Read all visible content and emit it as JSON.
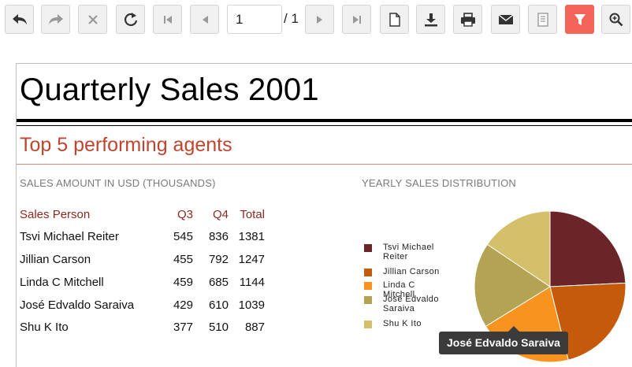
{
  "toolbar": {
    "current_page": "1",
    "total_pages": "/ 1",
    "buttons": [
      "back-icon",
      "forward-icon",
      "close-icon",
      "refresh-icon",
      "first-page-icon",
      "prev-page-icon",
      "next-page-icon",
      "last-page-icon",
      "document-icon",
      "download-icon",
      "print-icon",
      "email-icon",
      "document-map-icon",
      "filter-icon",
      "zoom-icon"
    ],
    "accent_color": "#f4645a"
  },
  "report": {
    "title": "Quarterly Sales 2001",
    "subtitle": "Top 5 performing agents",
    "sales_section_label": "SALES AMOUNT IN USD (THOUSANDS)",
    "chart_section_label": "YEARLY SALES DISTRIBUTION",
    "table": {
      "headers": [
        "Sales Person",
        "Q3",
        "Q4",
        "Total"
      ],
      "rows": [
        {
          "name": "Tsvi Michael Reiter",
          "q3": "545",
          "q4": "836",
          "total": "1381"
        },
        {
          "name": "Jillian  Carson",
          "q3": "455",
          "q4": "792",
          "total": "1247"
        },
        {
          "name": "Linda C Mitchell",
          "q3": "459",
          "q4": "685",
          "total": "1144"
        },
        {
          "name": "José Edvaldo Saraiva",
          "q3": "429",
          "q4": "610",
          "total": "1039"
        },
        {
          "name": "Shu K Ito",
          "q3": "377",
          "q4": "510",
          "total": "887"
        }
      ]
    },
    "legend": [
      {
        "label": "Tsvi Michael Reiter",
        "color": "#6b2428"
      },
      {
        "label": "Jillian  Carson",
        "color": "#c45a0a"
      },
      {
        "label": "Linda C Mitchell",
        "color": "#f7931e"
      },
      {
        "label": "José Edvaldo Saraiva",
        "color": "#b5a354"
      },
      {
        "label": "Shu K Ito",
        "color": "#d4c06a"
      }
    ],
    "tooltip": "José Edvaldo Saraiva"
  },
  "chart_data": {
    "type": "pie",
    "categories": [
      "Tsvi Michael Reiter",
      "Jillian  Carson",
      "Linda C Mitchell",
      "José Edvaldo Saraiva",
      "Shu K Ito"
    ],
    "values": [
      1381,
      1247,
      1144,
      1039,
      887
    ],
    "title": "YEARLY SALES DISTRIBUTION",
    "colors": [
      "#6b2428",
      "#c45a0a",
      "#f7931e",
      "#b5a354",
      "#d4c06a"
    ]
  }
}
